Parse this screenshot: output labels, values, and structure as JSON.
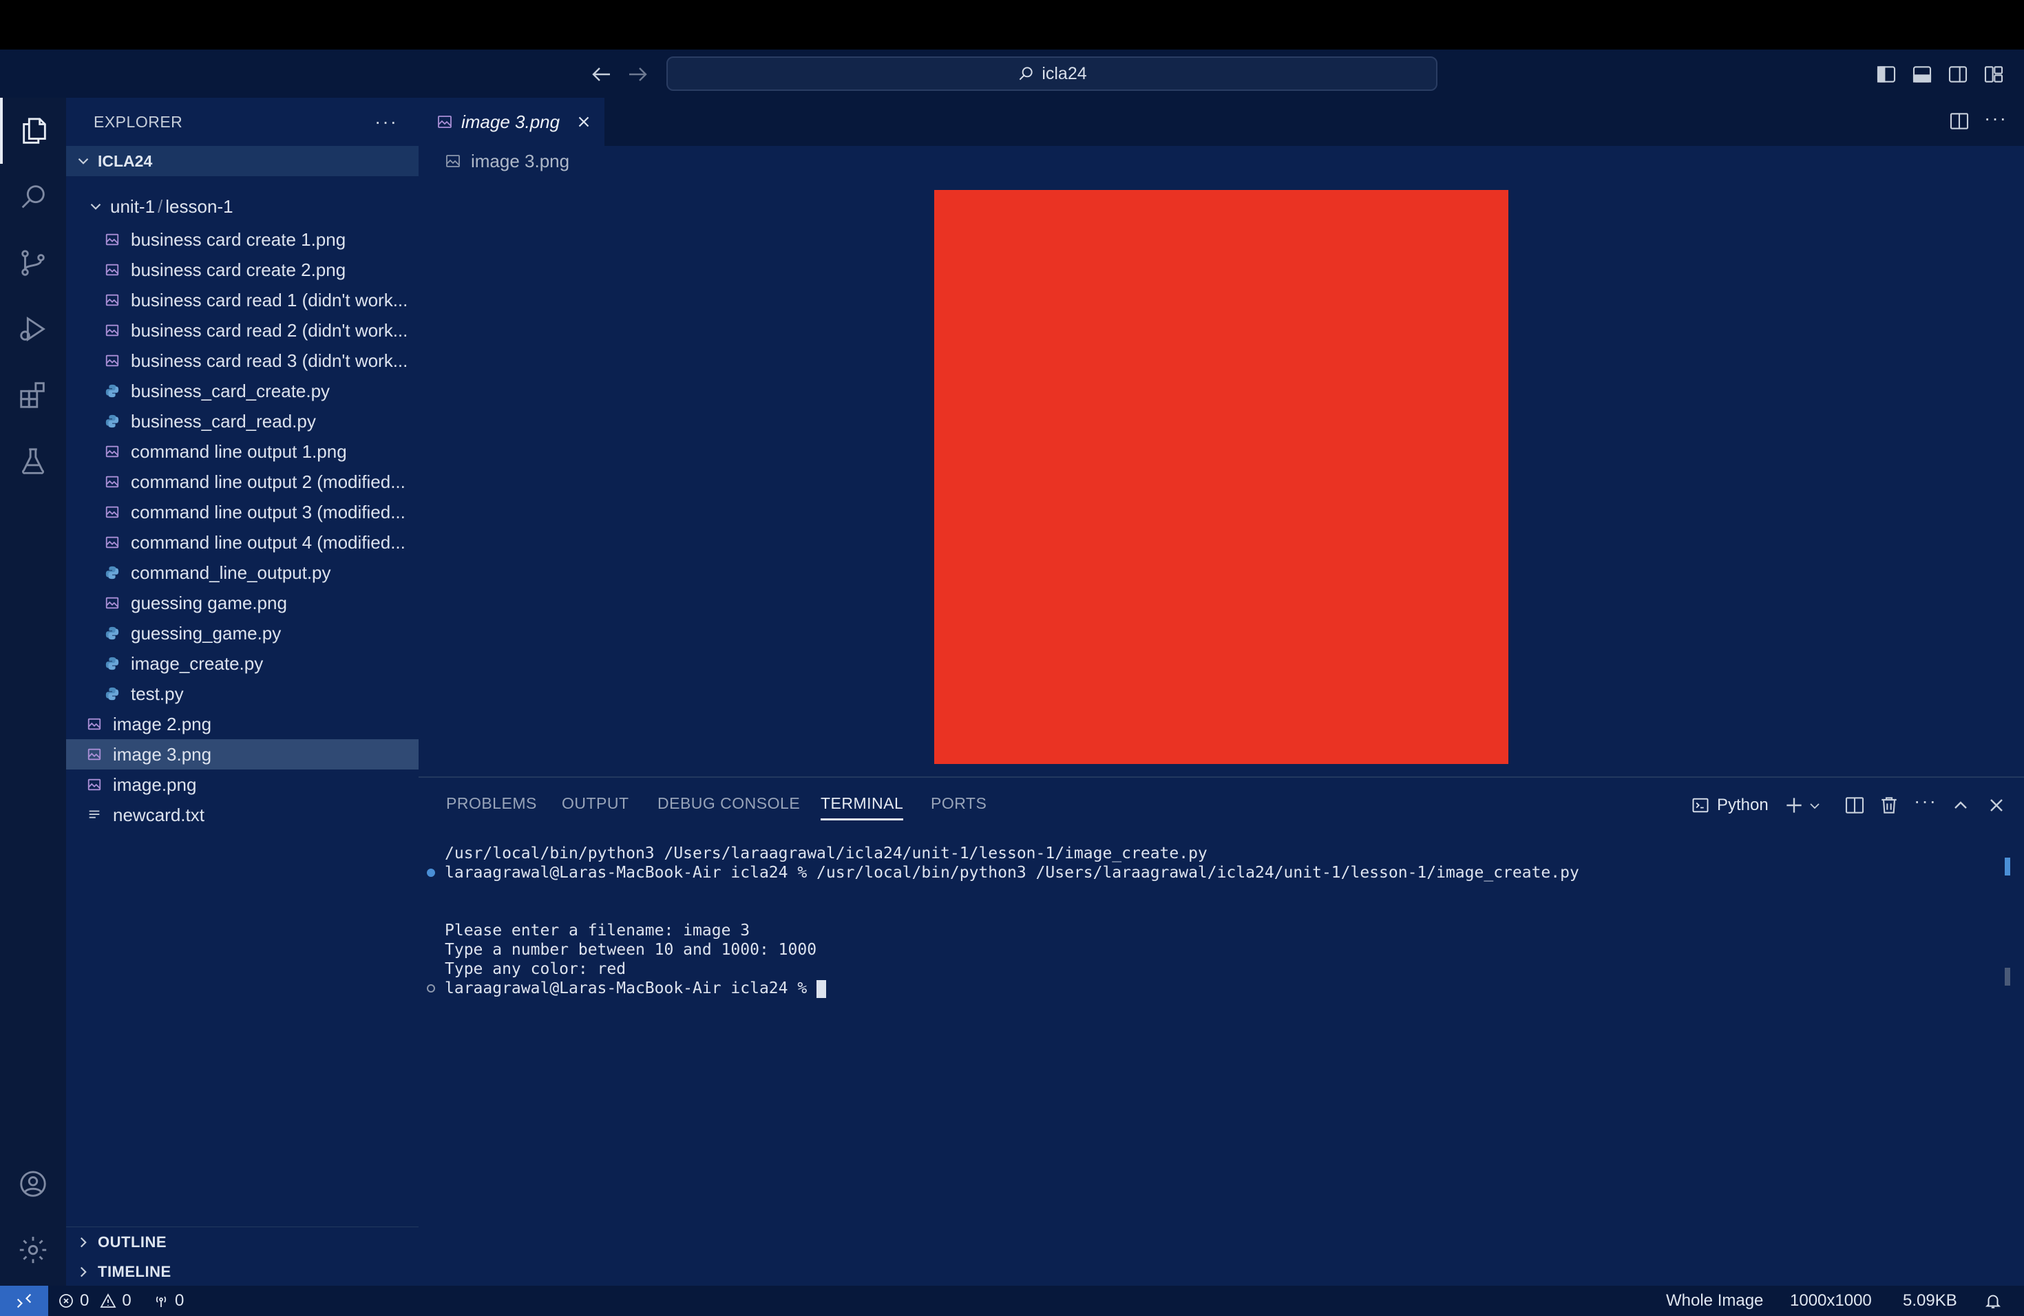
{
  "title_bar": {
    "search_text": "icla24"
  },
  "explorer": {
    "header": "EXPLORER",
    "root": "ICLA24",
    "folder": {
      "part1": "unit-1",
      "part2": "lesson-1"
    },
    "nested_files": [
      {
        "name": "business card create 1.png",
        "kind": "image"
      },
      {
        "name": "business card create 2.png",
        "kind": "image"
      },
      {
        "name": "business card read 1 (didn't work...",
        "kind": "image"
      },
      {
        "name": "business card read 2 (didn't work...",
        "kind": "image"
      },
      {
        "name": "business card read 3 (didn't work...",
        "kind": "image"
      },
      {
        "name": "business_card_create.py",
        "kind": "python"
      },
      {
        "name": "business_card_read.py",
        "kind": "python"
      },
      {
        "name": "command line output 1.png",
        "kind": "image"
      },
      {
        "name": "command line output 2 (modified...",
        "kind": "image"
      },
      {
        "name": "command line output 3 (modified...",
        "kind": "image"
      },
      {
        "name": "command line output 4 (modified...",
        "kind": "image"
      },
      {
        "name": "command_line_output.py",
        "kind": "python"
      },
      {
        "name": "guessing game.png",
        "kind": "image"
      },
      {
        "name": "guessing_game.py",
        "kind": "python"
      },
      {
        "name": "image_create.py",
        "kind": "python"
      },
      {
        "name": "test.py",
        "kind": "python"
      }
    ],
    "root_files": [
      {
        "name": "image 2.png",
        "kind": "image",
        "selected": false
      },
      {
        "name": "image 3.png",
        "kind": "image",
        "selected": true
      },
      {
        "name": "image.png",
        "kind": "image",
        "selected": false
      },
      {
        "name": "newcard.txt",
        "kind": "text",
        "selected": false
      }
    ],
    "sections": [
      "OUTLINE",
      "TIMELINE"
    ]
  },
  "editor": {
    "tab_label": "image 3.png",
    "breadcrumb": "image 3.png",
    "image_color": "#ea3323"
  },
  "panel": {
    "tabs": [
      "PROBLEMS",
      "OUTPUT",
      "DEBUG CONSOLE",
      "TERMINAL",
      "PORTS"
    ],
    "active_tab": "TERMINAL",
    "profile": "Python",
    "terminal_lines": [
      {
        "text": "/usr/local/bin/python3 /Users/laraagrawal/icla24/unit-1/lesson-1/image_create.py",
        "marker": "none"
      },
      {
        "text": "laraagrawal@Laras-MacBook-Air icla24 % /usr/local/bin/python3 /Users/laraagrawal/icla24/unit-1/lesson-1/image_create.py",
        "marker": "filled"
      },
      {
        "text": "",
        "marker": "none"
      },
      {
        "text": "",
        "marker": "none"
      },
      {
        "text": "Please enter a filename: image 3",
        "marker": "none"
      },
      {
        "text": "Type a number between 10 and 1000: 1000",
        "marker": "none"
      },
      {
        "text": "Type any color: red",
        "marker": "none"
      },
      {
        "text": "laraagrawal@Laras-MacBook-Air icla24 % ",
        "marker": "hollow",
        "cursor": true
      }
    ]
  },
  "status_bar": {
    "errors": "0",
    "warnings": "0",
    "ports": "0",
    "view_mode": "Whole Image",
    "dimensions": "1000x1000",
    "file_size": "5.09KB"
  },
  "colors": {
    "accent": "#2f67c2",
    "background": "#0b2150",
    "selection": "#304a74"
  }
}
